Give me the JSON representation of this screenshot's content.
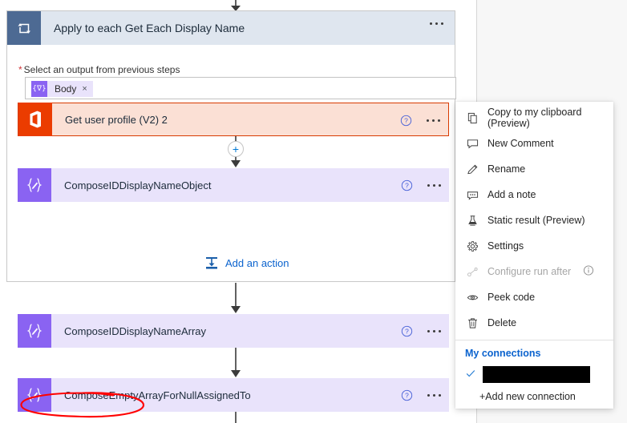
{
  "scope": {
    "icon": "loop-icon",
    "title": "Apply to each Get Each Display Name",
    "field_label": "Select an output from previous steps",
    "required_marker": "*",
    "token": {
      "icon": "expression-icon",
      "label": "Body",
      "remove": "×"
    },
    "add_action_label": "Add an action",
    "add_action_icon": "add-action-icon"
  },
  "cards": [
    {
      "name": "get-user-profile",
      "icon": "office365-icon",
      "title": "Get user profile (V2) 2",
      "help_icon": "help-icon",
      "more_icon": "ellipsis-icon"
    },
    {
      "name": "compose-id-display-name-object",
      "icon": "compose-icon",
      "title": "ComposeIDDisplayNameObject",
      "help_icon": "help-icon",
      "more_icon": "ellipsis-icon"
    },
    {
      "name": "compose-id-display-name-array",
      "icon": "compose-icon",
      "title": "ComposeIDDisplayNameArray",
      "help_icon": "help-icon",
      "more_icon": "ellipsis-icon"
    },
    {
      "name": "compose-empty-array-for-null-assigned-to",
      "icon": "compose-icon",
      "title": "ComposeEmptyArrayForNullAssignedTo",
      "help_icon": "help-icon",
      "more_icon": "ellipsis-icon"
    }
  ],
  "connector": {
    "plus_label": "+"
  },
  "menu": {
    "items": [
      {
        "icon": "copy-icon",
        "label": "Copy to my clipboard (Preview)",
        "disabled": false
      },
      {
        "icon": "comment-icon",
        "label": "New Comment",
        "disabled": false
      },
      {
        "icon": "pencil-icon",
        "label": "Rename",
        "disabled": false
      },
      {
        "icon": "note-icon",
        "label": "Add a note",
        "disabled": false
      },
      {
        "icon": "flask-icon",
        "label": "Static result (Preview)",
        "disabled": false
      },
      {
        "icon": "gear-icon",
        "label": "Settings",
        "disabled": false
      },
      {
        "icon": "runafter-icon",
        "label": "Configure run after",
        "disabled": true,
        "info_icon": "info-icon"
      },
      {
        "icon": "eye-icon",
        "label": "Peek code",
        "disabled": false
      },
      {
        "icon": "trash-icon",
        "label": "Delete",
        "disabled": false
      }
    ],
    "connections_header": "My connections",
    "connection_row": {
      "check_icon": "check-icon",
      "label": ""
    },
    "add_connection_label": "+Add new connection"
  },
  "colors": {
    "scope_header": "#dfe6ef",
    "scope_icon": "#4d6a93",
    "office_icon": "#eb3c00",
    "office_card_bg": "#fbe0d5",
    "office_card_border": "#d83b01",
    "compose_icon": "#8a63f2",
    "compose_card_bg": "#e9e3fb",
    "link_blue": "#0b63ce",
    "annotation_red": "#ff0000",
    "required_red": "#d13438"
  }
}
